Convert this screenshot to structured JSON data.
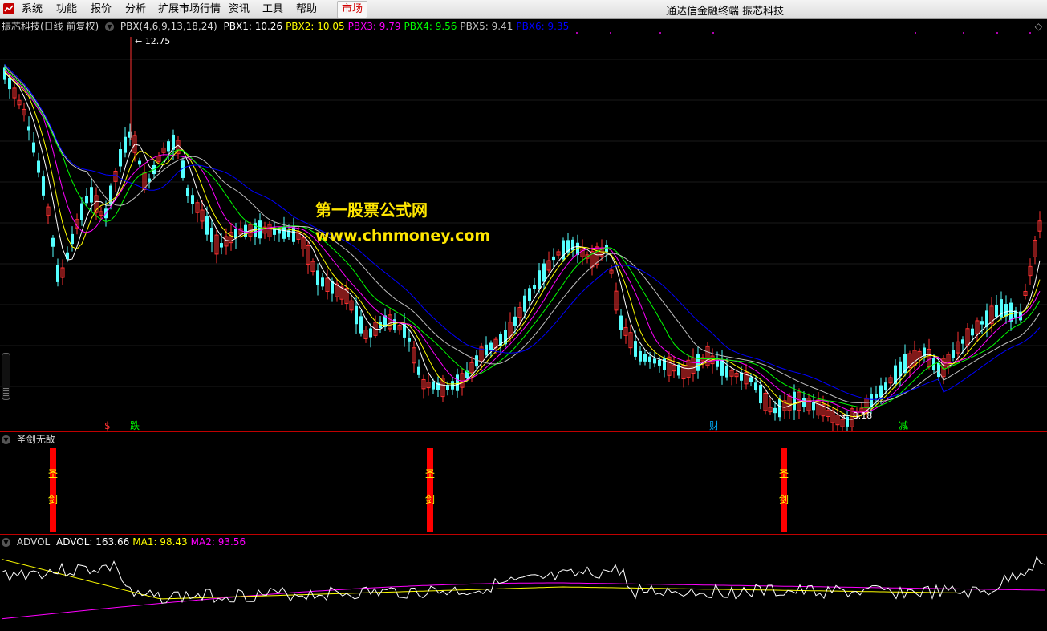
{
  "menubar": {
    "items": [
      "系统",
      "功能",
      "报价",
      "分析",
      "扩展市场行情",
      "资讯",
      "工具",
      "帮助"
    ],
    "market_button": "市场",
    "window_title": "通达信金融终端  振芯科技"
  },
  "price_panel": {
    "stock_label": "振芯科技(日线 前复权)",
    "indicator_name": "PBX(4,6,9,13,18,24)",
    "indicators": [
      {
        "label": "PBX1:",
        "value": "10.26",
        "color": "#ffffff"
      },
      {
        "label": "PBX2:",
        "value": "10.05",
        "color": "#ffff00"
      },
      {
        "label": "PBX3:",
        "value": "9.79",
        "color": "#ff00ff"
      },
      {
        "label": "PBX4:",
        "value": "9.56",
        "color": "#00ff00"
      },
      {
        "label": "PBX5:",
        "value": "9.41",
        "color": "#c0c0c0"
      },
      {
        "label": "PBX6:",
        "value": "9.35",
        "color": "#0000ff"
      }
    ],
    "high_label": "12.75",
    "low_label": "8.18",
    "signal_marks": [
      "$",
      "跌",
      "财",
      "减"
    ],
    "colors": {
      "up": "#ff3232",
      "down": "#54ffff"
    }
  },
  "sword_panel": {
    "title": "圣剑无敌",
    "bar_text": [
      "圣",
      "剑"
    ]
  },
  "advol_panel": {
    "title": "ADVOL",
    "values": [
      {
        "label": "ADVOL:",
        "value": "163.66",
        "color": "#ffffff"
      },
      {
        "label": "MA1:",
        "value": "98.43",
        "color": "#ffff00"
      },
      {
        "label": "MA2:",
        "value": "93.56",
        "color": "#ff00ff"
      }
    ]
  },
  "watermark": {
    "line1": "第一股票公式网",
    "line2": "www.chnmoney.com"
  }
}
